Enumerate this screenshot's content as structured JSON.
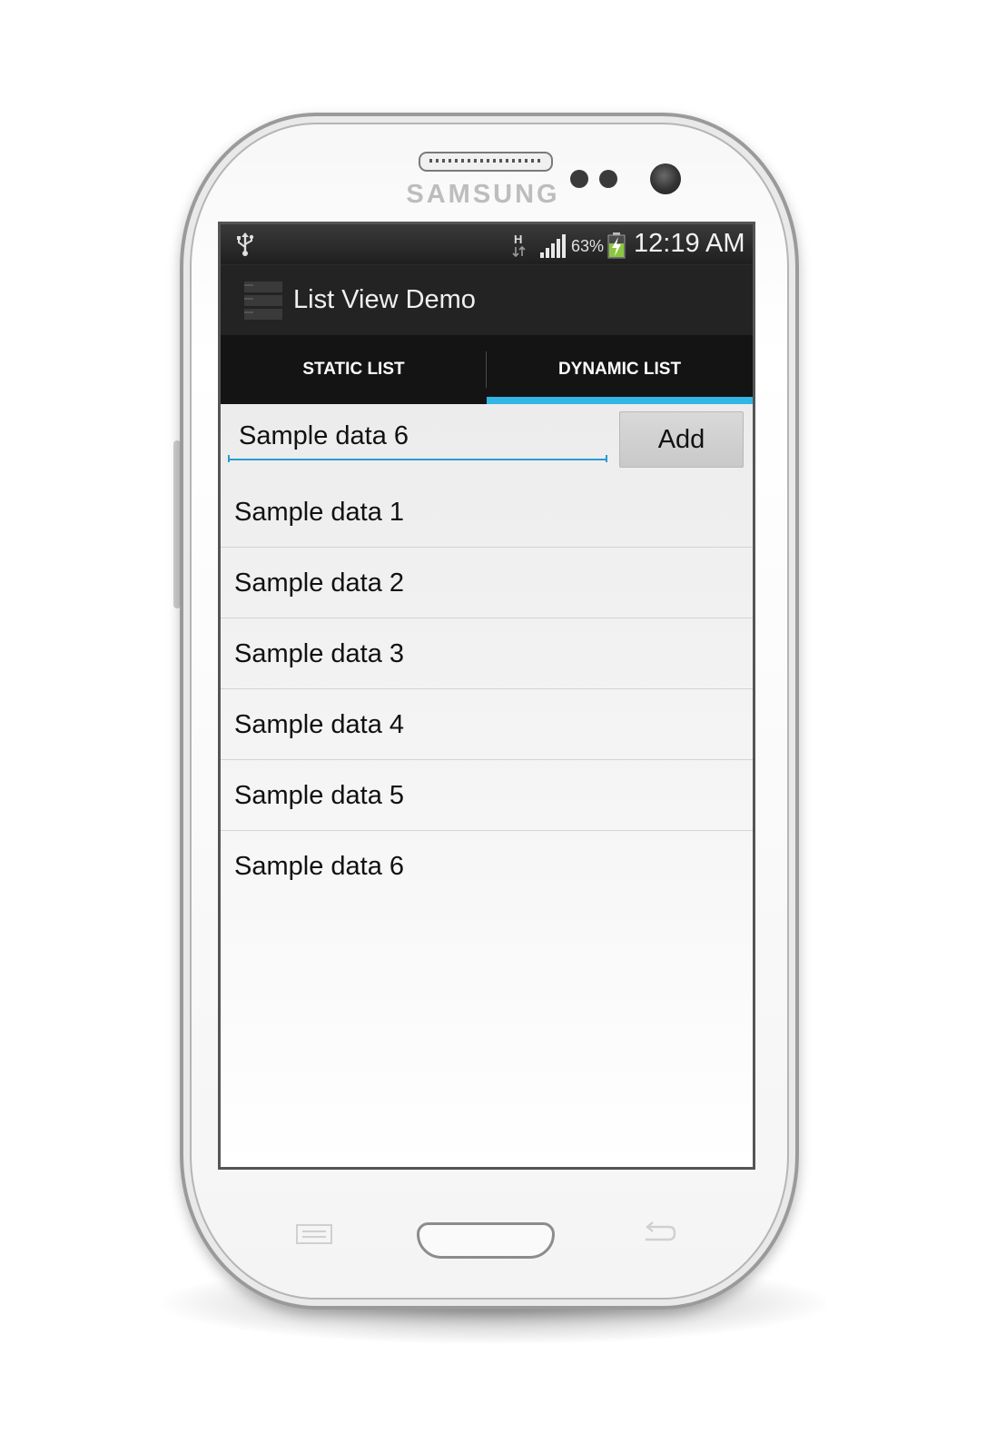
{
  "device": {
    "brand": "SAMSUNG"
  },
  "status_bar": {
    "usb_icon": "usb-icon",
    "network_icon": "h-data-icon",
    "signal_icon": "signal-icon",
    "battery_percent": "63%",
    "battery_icon": "battery-charging-icon",
    "time": "12:19 AM"
  },
  "action_bar": {
    "app_icon": "list-app-icon",
    "title": "List View Demo"
  },
  "tabs": [
    {
      "label": "STATIC LIST",
      "selected": false
    },
    {
      "label": "DYNAMIC LIST",
      "selected": true
    }
  ],
  "input": {
    "value": "Sample data 6",
    "add_label": "Add"
  },
  "list_items": [
    "Sample data 1",
    "Sample data 2",
    "Sample data 3",
    "Sample data 4",
    "Sample data 5",
    "Sample data 6"
  ],
  "colors": {
    "accent": "#33b5e5",
    "action_bar": "#232323",
    "tab_bar": "#141414"
  }
}
